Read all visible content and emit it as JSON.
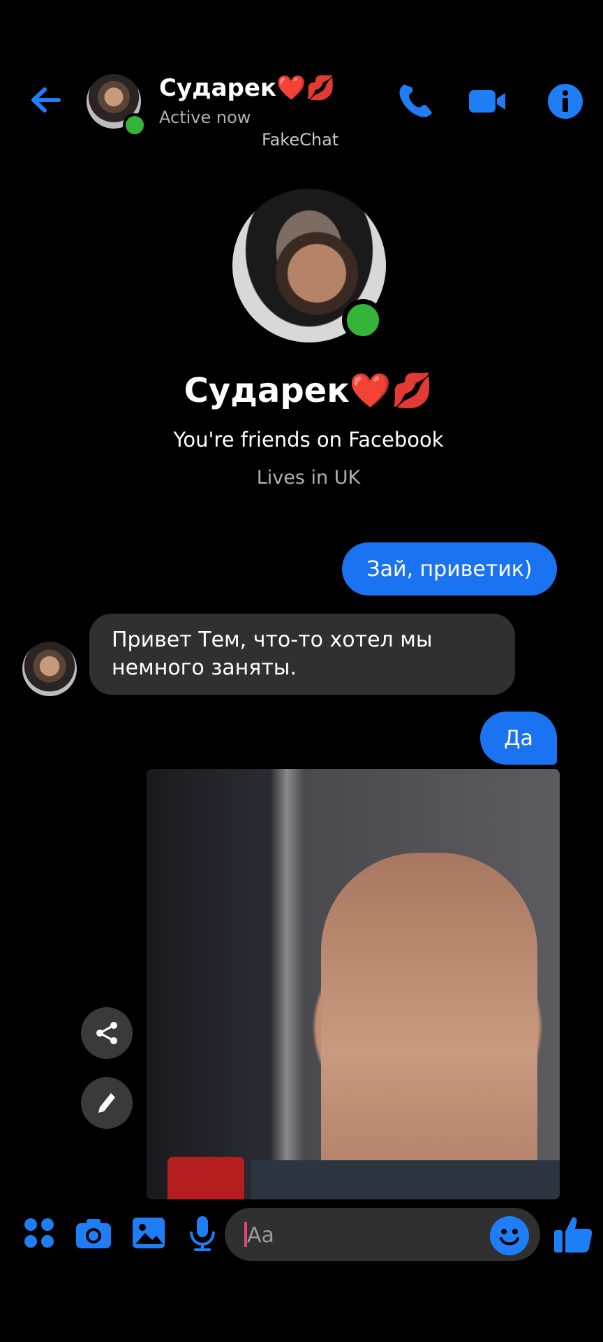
{
  "header": {
    "name": "Сударек❤️💋",
    "status": "Active now",
    "watermark": "FakeChat"
  },
  "profile": {
    "name": "Сударек❤️💋",
    "friends_text": "You're friends on Facebook",
    "location": "Lives in UK"
  },
  "messages": [
    {
      "direction": "out",
      "text": "Зай, приветик)"
    },
    {
      "direction": "in",
      "text": "Привет Тем, что-то хотел мы немного заняты."
    },
    {
      "direction": "out",
      "text": "Да"
    }
  ],
  "composer": {
    "placeholder": "Aa"
  },
  "colors": {
    "accent": "#1f7df5",
    "outgoing_bubble": "#1a73f0",
    "incoming_bubble": "#303030",
    "online": "#34b438"
  },
  "icons": [
    "back-arrow-icon",
    "phone-icon",
    "video-camera-icon",
    "info-icon",
    "share-icon",
    "pencil-icon",
    "apps-icon",
    "camera-icon",
    "image-icon",
    "microphone-icon",
    "emoji-icon",
    "thumbs-up-icon"
  ]
}
